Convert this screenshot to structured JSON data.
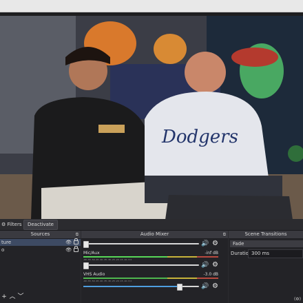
{
  "toolbar": {
    "filters_label": "Filters",
    "deactivate_label": "Deactivate"
  },
  "sources": {
    "title": "Sources",
    "items": [
      {
        "label": "ture",
        "visible": true,
        "locked": true
      },
      {
        "label": "o",
        "visible": true,
        "locked": true
      }
    ]
  },
  "mixer": {
    "title": "Audio Mixer",
    "ticks": "-60 -55 -50 -45 -40 -35 -30 -25 -20 -15 -10 -5 0",
    "channels": [
      {
        "name": "",
        "db": "",
        "volume": 0.02
      },
      {
        "name": "Mic/Aux",
        "db": "-inf dB",
        "volume": 0.02
      },
      {
        "name": "VHS Audio",
        "db": "-3.0 dB",
        "volume": 0.83
      }
    ]
  },
  "transitions": {
    "title": "Scene Transitions",
    "selected": "Fade",
    "duration_label": "Duration",
    "duration_value": "300 ms"
  },
  "icons": {
    "volume": "speaker-icon",
    "settings": "gear-icon",
    "visibility": "eye-icon",
    "lock": "lock-icon",
    "add": "plus-icon",
    "up": "arrow-up-icon",
    "down": "arrow-down-icon"
  }
}
